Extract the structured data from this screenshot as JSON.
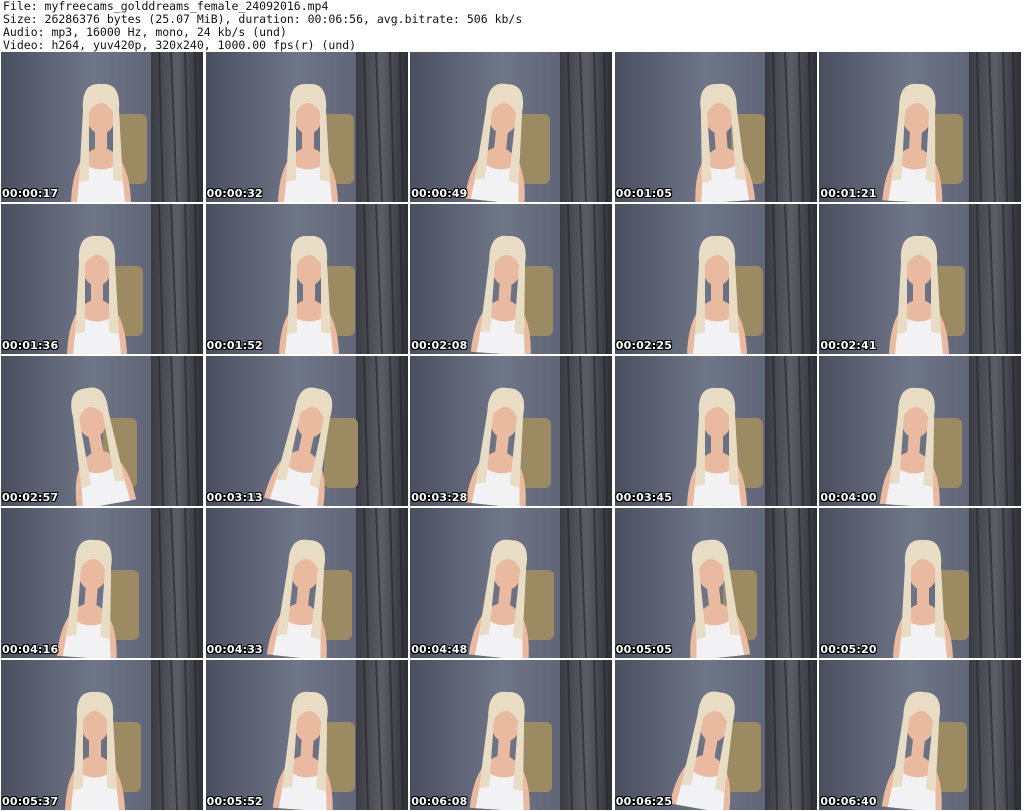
{
  "header": {
    "file_line": "File: myfreecams_golddreams_female_24092016.mp4",
    "size_line": "Size: 26286376 bytes (25.07 MiB), duration: 00:06:56, avg.bitrate: 506 kb/s",
    "audio_line": "Audio: mp3, 16000 Hz, mono, 24 kb/s (und)",
    "video_line": "Video: h264, yuv420p, 320x240, 1000.00 fps(r) (und)"
  },
  "thumbnails": [
    {
      "timestamp": "00:00:17"
    },
    {
      "timestamp": "00:00:32"
    },
    {
      "timestamp": "00:00:49"
    },
    {
      "timestamp": "00:01:05"
    },
    {
      "timestamp": "00:01:21"
    },
    {
      "timestamp": "00:01:36"
    },
    {
      "timestamp": "00:01:52"
    },
    {
      "timestamp": "00:02:08"
    },
    {
      "timestamp": "00:02:25"
    },
    {
      "timestamp": "00:02:41"
    },
    {
      "timestamp": "00:02:57"
    },
    {
      "timestamp": "00:03:13"
    },
    {
      "timestamp": "00:03:28"
    },
    {
      "timestamp": "00:03:45"
    },
    {
      "timestamp": "00:04:00"
    },
    {
      "timestamp": "00:04:16"
    },
    {
      "timestamp": "00:04:33"
    },
    {
      "timestamp": "00:04:48"
    },
    {
      "timestamp": "00:05:05"
    },
    {
      "timestamp": "00:05:20"
    },
    {
      "timestamp": "00:05:37"
    },
    {
      "timestamp": "00:05:52"
    },
    {
      "timestamp": "00:06:08"
    },
    {
      "timestamp": "00:06:25"
    },
    {
      "timestamp": "00:06:40"
    }
  ],
  "colors": {
    "background": "#ffffff",
    "wall": "#6f7688",
    "curtain": "#2e2f36",
    "hair": "#e8dcc4",
    "skin": "#e9b9a0",
    "top": "#f2f2f4",
    "chair": "#9c8a62",
    "timestamp_text": "#ffffff"
  }
}
